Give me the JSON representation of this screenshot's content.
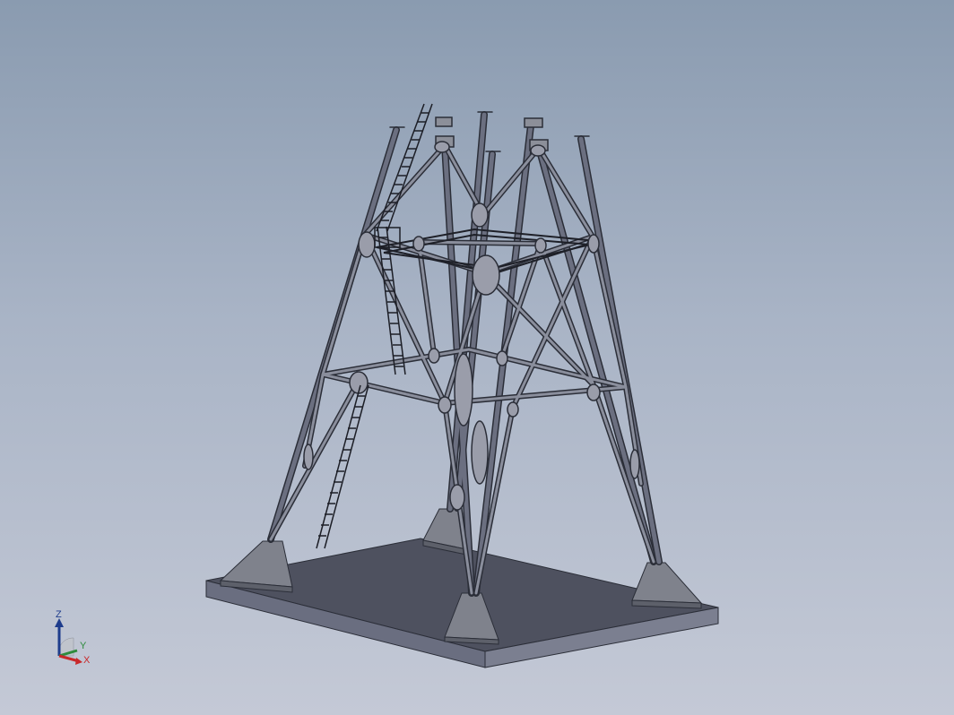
{
  "viewport": {
    "background_top": "#8a9bb0",
    "background_bottom": "#c4c9d6"
  },
  "model": {
    "name": "tower-frame-assembly",
    "components": [
      "base-plate",
      "foundation-pedestals",
      "tube-legs",
      "cross-braces",
      "ring-beams",
      "ladder",
      "upper-platform"
    ],
    "colors": {
      "steel": "#6b6f80",
      "steel_edge": "#2b2e38",
      "base_top": "#4e515f",
      "base_side": "#6a6e80",
      "pedestal": "#7f828c"
    }
  },
  "triad": {
    "z_label": "Z",
    "y_label": "Y",
    "x_label": "X",
    "z_color": "#1e3c8c",
    "y_color": "#2e8b3c",
    "x_color": "#c8282a"
  }
}
